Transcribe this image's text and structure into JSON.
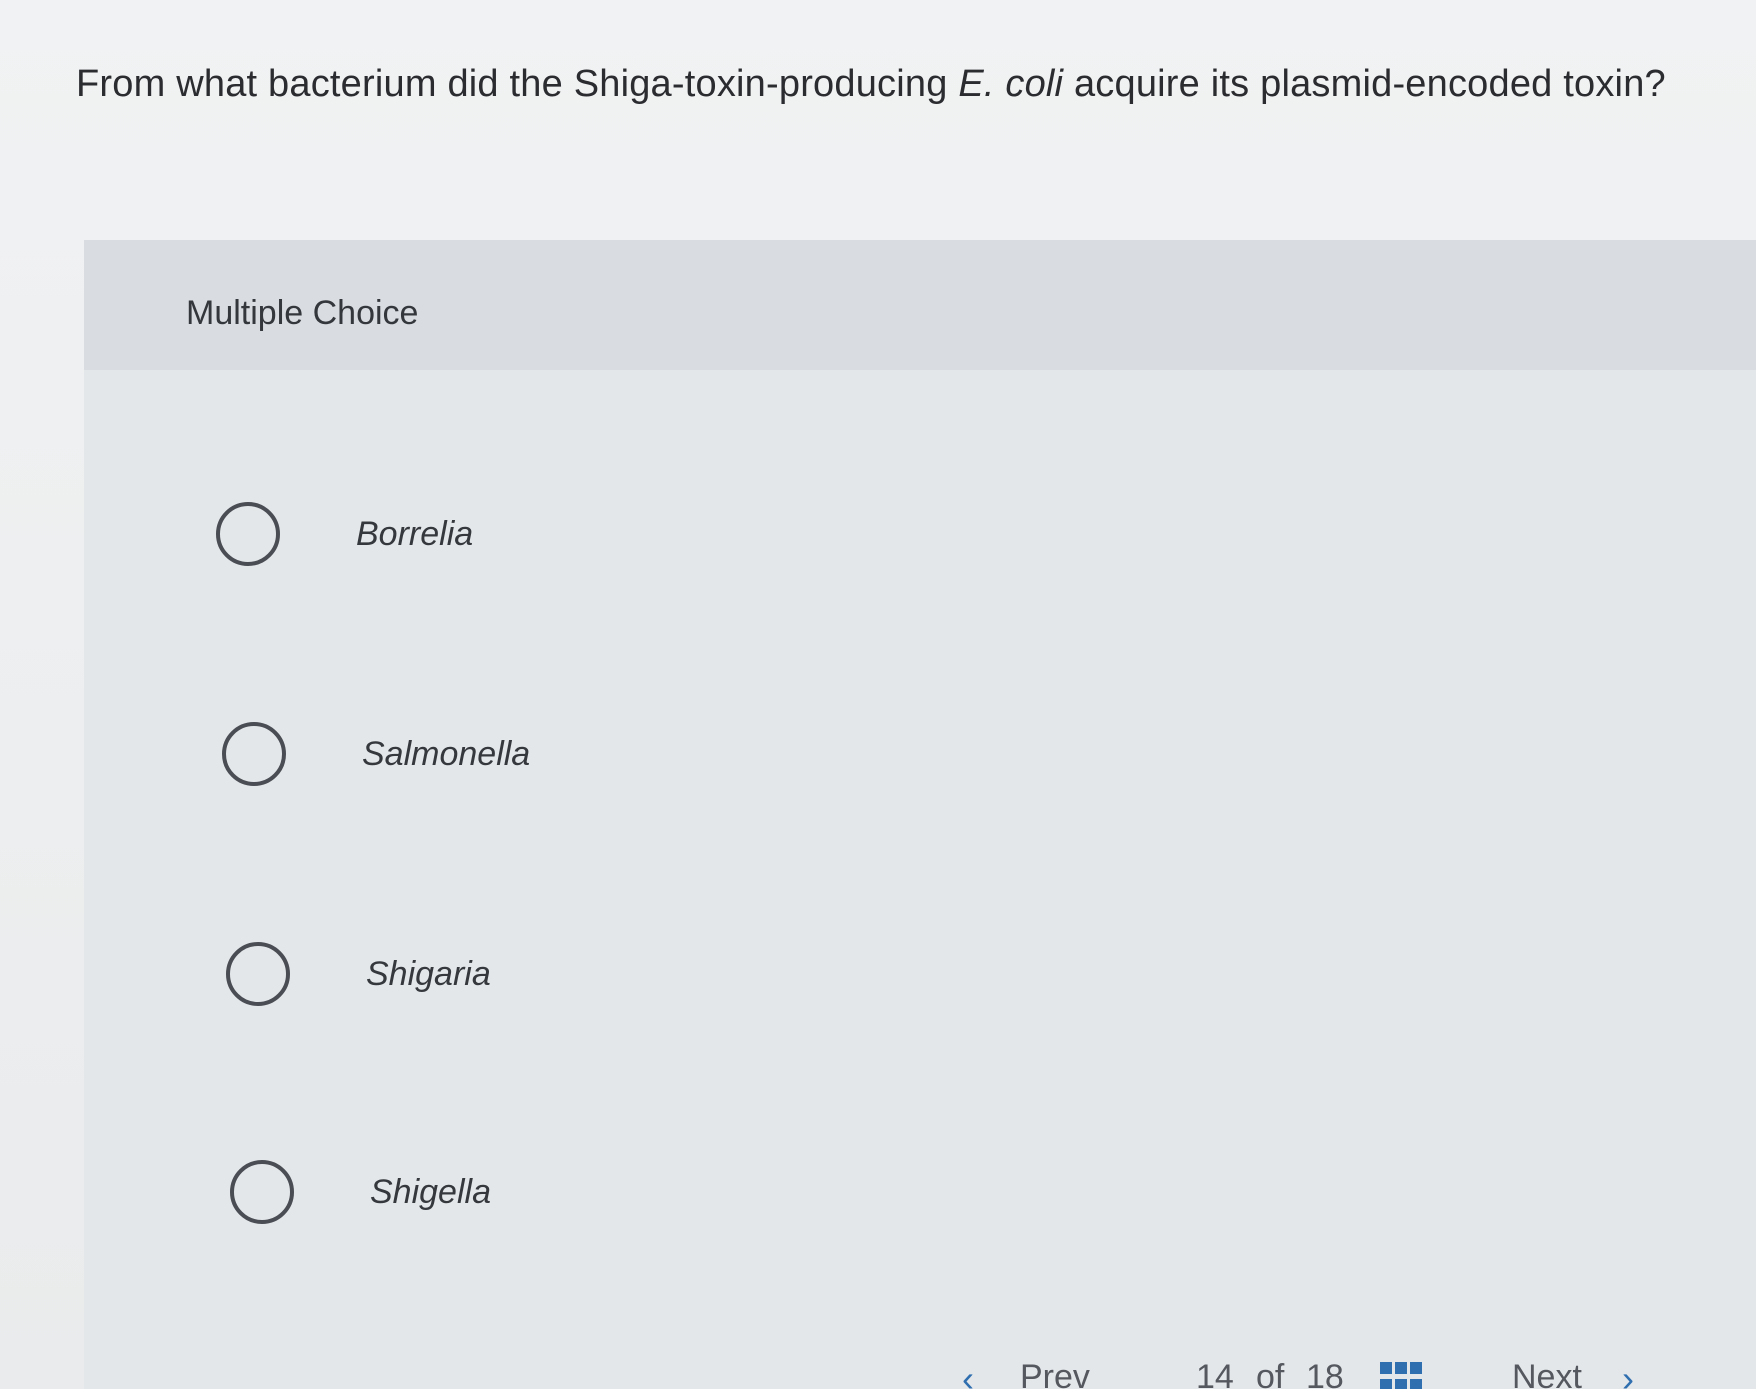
{
  "question": {
    "before": "From what bacterium did the Shiga-toxin-producing ",
    "italic": "E. coli",
    "after": " acquire its plasmid-encoded toxin?"
  },
  "section_label": "Multiple Choice",
  "options": [
    {
      "label": "Borrelia"
    },
    {
      "label": "Salmonella"
    },
    {
      "label": "Shigaria"
    },
    {
      "label": "Shigella"
    }
  ],
  "footer": {
    "prev_label": "Prev",
    "position_current": "14",
    "position_of": "of",
    "position_total": "18",
    "next_label": "Next",
    "accent_color": "#2f6fb0"
  }
}
